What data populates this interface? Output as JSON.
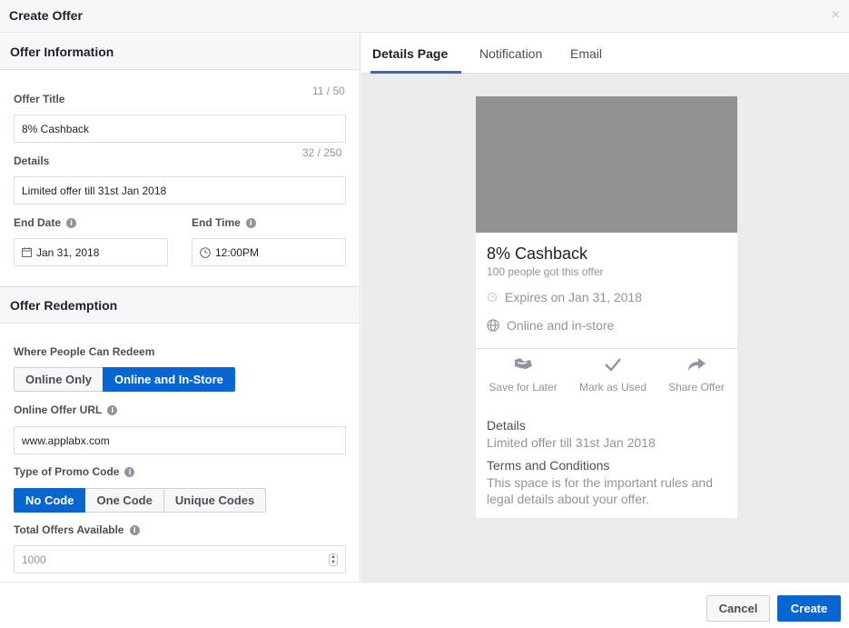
{
  "header": {
    "title": "Create Offer",
    "close": "×"
  },
  "offer_info": {
    "section_title": "Offer Information",
    "title_label": "Offer Title",
    "title_counter": "11 / 50",
    "title_value": "8% Cashback",
    "details_label": "Details",
    "details_counter": "32 / 250",
    "details_value": "Limited offer till 31st Jan 2018",
    "end_date_label": "End Date",
    "end_date_value": "Jan 31, 2018",
    "end_time_label": "End Time",
    "end_time_value": "12:00PM"
  },
  "redemption": {
    "section_title": "Offer Redemption",
    "where_label": "Where People Can Redeem",
    "where_options": [
      "Online Only",
      "Online and In-Store"
    ],
    "where_selected": "Online and In-Store",
    "url_label": "Online Offer URL",
    "url_value": "www.applabx.com",
    "promo_label": "Type of Promo Code",
    "promo_options": [
      "No Code",
      "One Code",
      "Unique Codes"
    ],
    "promo_selected": "No Code",
    "total_label": "Total Offers Available",
    "total_placeholder": "1000"
  },
  "preview": {
    "tabs": [
      "Details Page",
      "Notification",
      "Email"
    ],
    "active_tab": "Details Page",
    "card": {
      "title": "8% Cashback",
      "subtitle": "100 people got this offer",
      "expires": "Expires on Jan 31, 2018",
      "location": "Online and in-store",
      "actions": [
        "Save for Later",
        "Mark as Used",
        "Share Offer"
      ],
      "details_heading": "Details",
      "details_text": "Limited offer till 31st Jan 2018",
      "terms_heading": "Terms and Conditions",
      "terms_text": "This space is for the important rules and legal details about your offer."
    }
  },
  "footer": {
    "cancel": "Cancel",
    "create": "Create"
  },
  "colors": {
    "primary": "#0866d0",
    "tab_underline": "#4267b2",
    "preview_bg": "#e9ebee",
    "image_placeholder": "#909294"
  },
  "icons": [
    "close-icon",
    "info-icon",
    "calendar-icon",
    "clock-icon",
    "globe-icon",
    "save-icon",
    "check-icon",
    "share-icon",
    "stepper-icon"
  ]
}
